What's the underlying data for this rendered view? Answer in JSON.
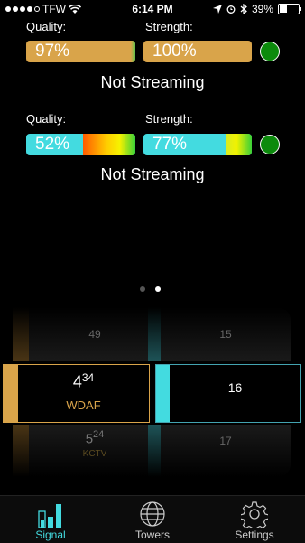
{
  "status_bar": {
    "carrier": "TFW",
    "time": "6:14 PM",
    "battery_percent": "39%",
    "battery_level": 0.39
  },
  "tuner1": {
    "quality_label": "Quality:",
    "strength_label": "Strength:",
    "quality_value": "97%",
    "strength_value": "100%",
    "status": "Not Streaming",
    "indicator_color": "#0c8a0c"
  },
  "tuner2": {
    "quality_label": "Quality:",
    "strength_label": "Strength:",
    "quality_value": "52%",
    "strength_value": "77%",
    "status": "Not Streaming",
    "indicator_color": "#0c8a0c"
  },
  "pager": {
    "count": 2,
    "active": 1
  },
  "channels_left": {
    "above": "49",
    "selected_major": "4",
    "selected_minor": "34",
    "selected_callsign": "WDAF",
    "below_major": "5",
    "below_minor": "24",
    "below_callsign": "KCTV"
  },
  "channels_right": {
    "above": "15",
    "selected": "16",
    "below": "17"
  },
  "colors": {
    "accent_orange": "#d9a44a",
    "accent_teal": "#43dbe0"
  },
  "tabs": [
    {
      "label": "Signal",
      "icon": "signal-bars-icon",
      "active": true
    },
    {
      "label": "Towers",
      "icon": "globe-icon",
      "active": false
    },
    {
      "label": "Settings",
      "icon": "gear-icon",
      "active": false
    }
  ]
}
